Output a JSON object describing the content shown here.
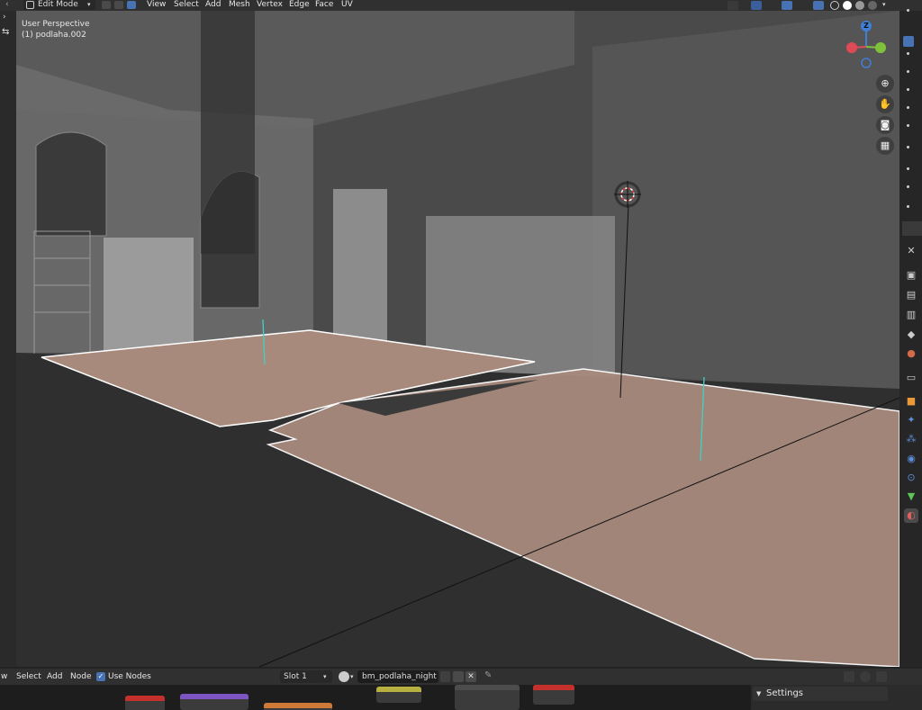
{
  "header": {
    "mode": "Edit Mode",
    "menus": [
      "View",
      "Select",
      "Add",
      "Mesh",
      "Vertex",
      "Edge",
      "Face",
      "UV"
    ]
  },
  "viewport": {
    "perspective": "User Perspective",
    "object": "(1) podlaha.002"
  },
  "gizmo": {
    "z_label": "Z",
    "x_color": "#e04a57",
    "y_color": "#7ec13b",
    "z_color": "#3f7fd6"
  },
  "nav_buttons": [
    "zoom-icon",
    "hand-icon",
    "camera-icon",
    "grid-icon"
  ],
  "properties_tabs": [
    "tool-icon",
    "render-icon",
    "output-icon",
    "view-layer-icon",
    "scene-icon",
    "world-icon",
    "collection-icon",
    "object-icon",
    "modifier-icon",
    "particles-icon",
    "physics-icon",
    "constraints-icon",
    "data-icon",
    "material-icon"
  ],
  "node_editor": {
    "menus": [
      "w",
      "Select",
      "Add",
      "Node"
    ],
    "use_nodes_label": "Use Nodes",
    "use_nodes_checked": true,
    "slot": "Slot 1",
    "material": "bm_podlaha_night"
  },
  "settings": {
    "label": "Settings"
  },
  "colors": {
    "accent": "#4772b3",
    "floor": "#a88a7c",
    "selection_edge": "#ffffff"
  }
}
